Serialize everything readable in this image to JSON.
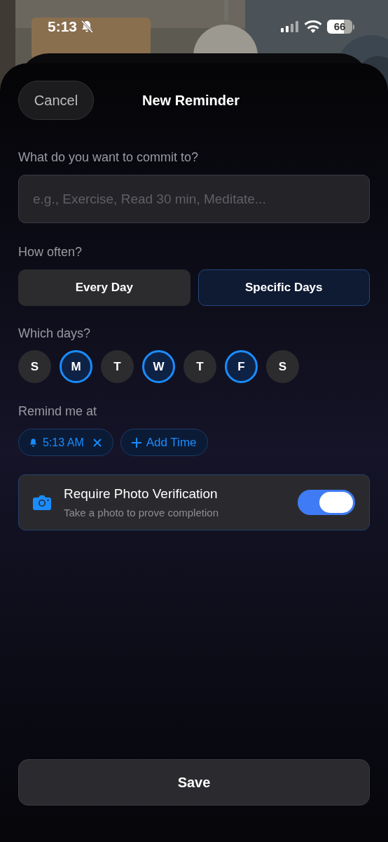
{
  "status_bar": {
    "time": "5:13",
    "battery": "66"
  },
  "header": {
    "cancel": "Cancel",
    "title": "New Reminder"
  },
  "commitment": {
    "label": "What do you want to commit to?",
    "placeholder": "e.g., Exercise, Read 30 min, Meditate..."
  },
  "frequency": {
    "label": "How often?",
    "options": [
      {
        "label": "Every Day",
        "selected": false
      },
      {
        "label": "Specific Days",
        "selected": true
      }
    ]
  },
  "days": {
    "label": "Which days?",
    "items": [
      {
        "label": "S",
        "selected": false
      },
      {
        "label": "M",
        "selected": true
      },
      {
        "label": "T",
        "selected": false
      },
      {
        "label": "W",
        "selected": true
      },
      {
        "label": "T",
        "selected": false
      },
      {
        "label": "F",
        "selected": true
      },
      {
        "label": "S",
        "selected": false
      }
    ]
  },
  "reminder_times": {
    "label": "Remind me at",
    "times": [
      {
        "label": "5:13 AM"
      }
    ],
    "add_label": "Add Time"
  },
  "photo_verification": {
    "title": "Require Photo Verification",
    "subtitle": "Take a photo to prove completion",
    "on": true
  },
  "save": "Save"
}
